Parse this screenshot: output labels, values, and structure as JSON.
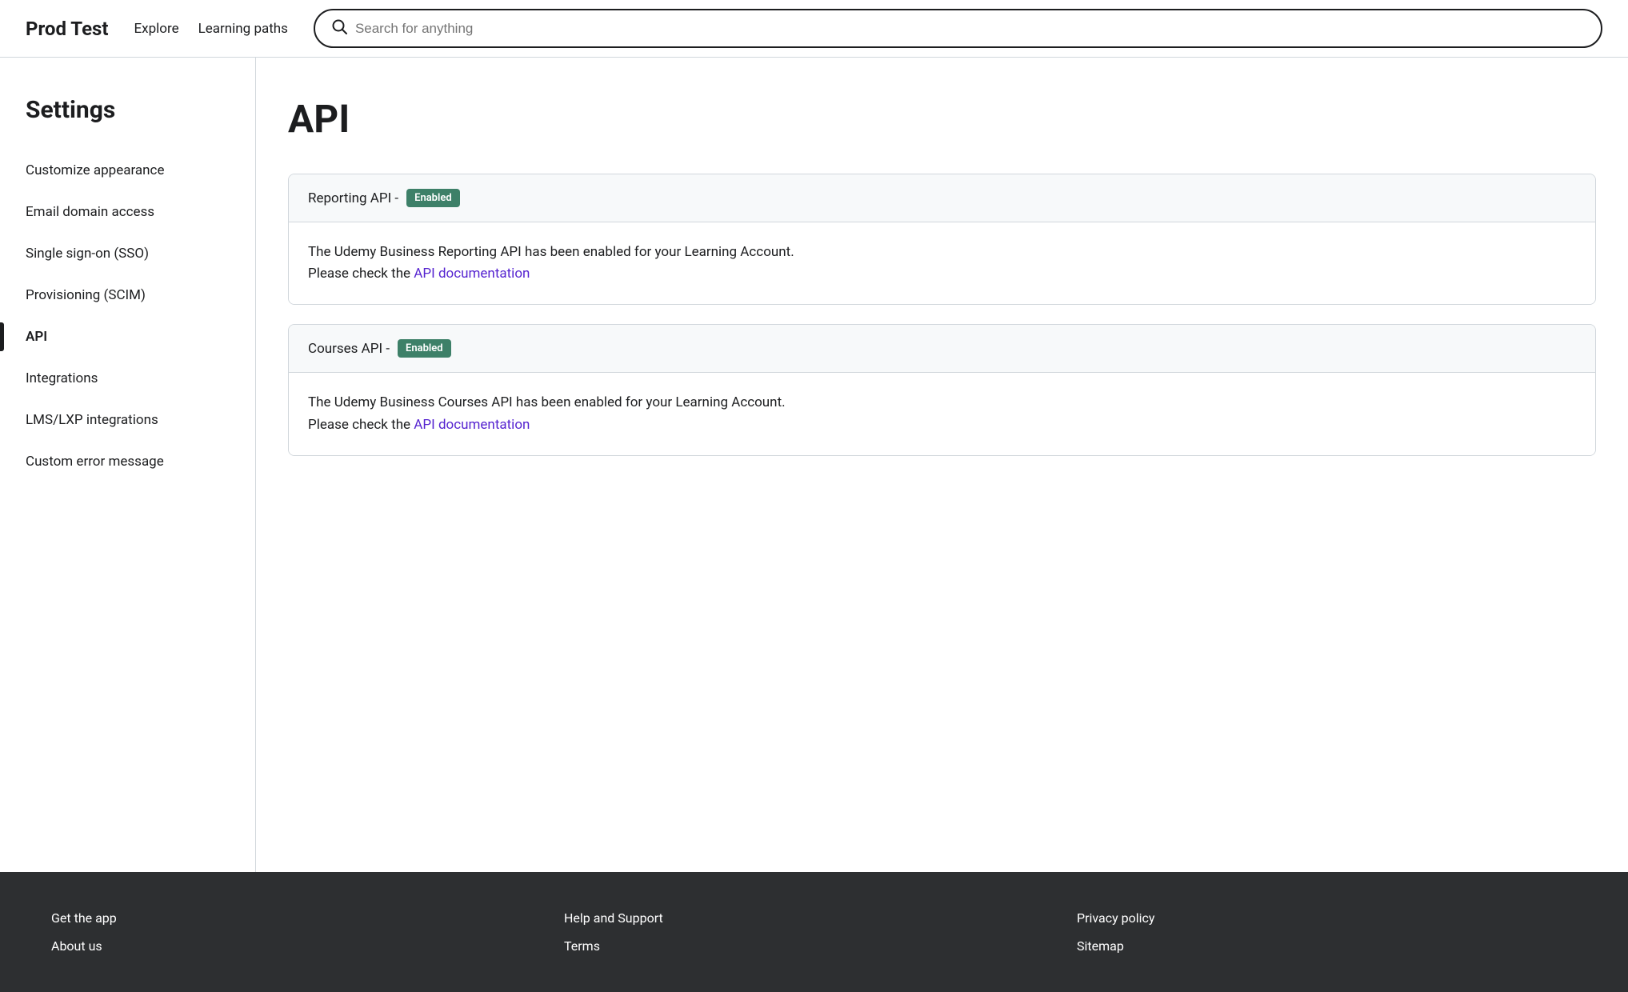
{
  "header": {
    "logo": "Prod Test",
    "nav": [
      {
        "label": "Explore"
      },
      {
        "label": "Learning paths"
      }
    ],
    "search_placeholder": "Search for anything"
  },
  "sidebar": {
    "title": "Settings",
    "items": [
      {
        "label": "Customize appearance",
        "active": false
      },
      {
        "label": "Email domain access",
        "active": false
      },
      {
        "label": "Single sign-on (SSO)",
        "active": false
      },
      {
        "label": "Provisioning (SCIM)",
        "active": false
      },
      {
        "label": "API",
        "active": true
      },
      {
        "label": "Integrations",
        "active": false
      },
      {
        "label": "LMS/LXP integrations",
        "active": false
      },
      {
        "label": "Custom error message",
        "active": false
      }
    ]
  },
  "main": {
    "title": "API",
    "cards": [
      {
        "header_text": "Reporting API -",
        "status": "Enabled",
        "body_line1": "The Udemy Business Reporting API has been enabled for your Learning Account.",
        "body_line2_prefix": "Please check the ",
        "body_link": "API documentation",
        "body_line2_suffix": ""
      },
      {
        "header_text": "Courses API -",
        "status": "Enabled",
        "body_line1": "The Udemy Business Courses API has been enabled for your Learning Account.",
        "body_line2_prefix": "Please check the ",
        "body_link": "API documentation",
        "body_line2_suffix": ""
      }
    ]
  },
  "footer": {
    "columns": [
      {
        "links": [
          "Get the app",
          "About us"
        ]
      },
      {
        "links": [
          "Help and Support",
          "Terms"
        ]
      },
      {
        "links": [
          "Privacy policy",
          "Sitemap"
        ]
      }
    ]
  }
}
